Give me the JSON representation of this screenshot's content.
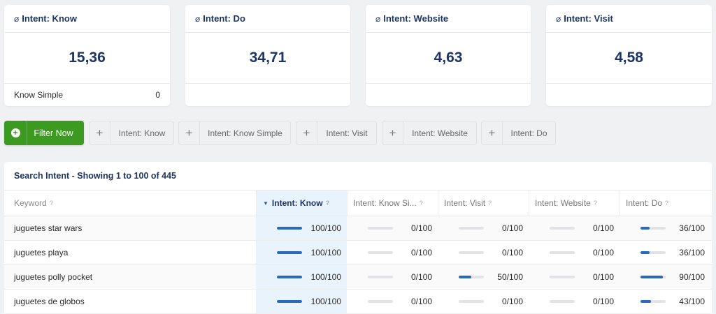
{
  "cards": [
    {
      "symbol": "⌀",
      "title": "Intent: Know",
      "value": "15,36",
      "footer_label": "Know Simple",
      "footer_value": "0"
    },
    {
      "symbol": "⌀",
      "title": "Intent: Do",
      "value": "34,71"
    },
    {
      "symbol": "⌀",
      "title": "Intent: Website",
      "value": "4,63"
    },
    {
      "symbol": "⌀",
      "title": "Intent: Visit",
      "value": "4,58"
    }
  ],
  "filters": {
    "filter_now_label": "Filter Now",
    "chips": [
      "Intent: Know",
      "Intent: Know Simple",
      "Intent: Visit",
      "Intent: Website",
      "Intent: Do"
    ],
    "chip_icon": "plus-icon"
  },
  "table": {
    "title": "Search Intent - Showing 1 to 100 of 445",
    "columns": [
      "Keyword",
      "Intent: Know",
      "Intent: Know Si...",
      "Intent: Visit",
      "Intent: Website",
      "Intent: Do"
    ],
    "help_mark": "?",
    "sorted_column": "Intent: Know",
    "rows": [
      {
        "keyword": "juguetes star wars",
        "know": "100/100",
        "know_simple": "0/100",
        "visit": "0/100",
        "website": "0/100",
        "do": "36/100"
      },
      {
        "keyword": "juguetes playa",
        "know": "100/100",
        "know_simple": "0/100",
        "visit": "0/100",
        "website": "0/100",
        "do": "36/100"
      },
      {
        "keyword": "juguetes polly pocket",
        "know": "100/100",
        "know_simple": "0/100",
        "visit": "50/100",
        "website": "0/100",
        "do": "90/100"
      },
      {
        "keyword": "juguetes de globos",
        "know": "100/100",
        "know_simple": "0/100",
        "visit": "0/100",
        "website": "0/100",
        "do": "43/100"
      }
    ]
  },
  "colors": {
    "accent_navy": "#1c3565",
    "bar_blue": "#2a69bd",
    "filter_green": "#3b9a1f",
    "highlight_column": "#e9f3fb"
  }
}
